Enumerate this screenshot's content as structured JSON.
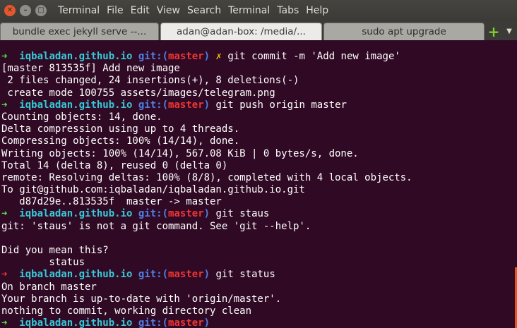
{
  "window": {
    "menu": [
      "Terminal",
      "File",
      "Edit",
      "View",
      "Search",
      "Terminal",
      "Tabs",
      "Help"
    ]
  },
  "tabs": [
    {
      "label": "bundle exec jekyll serve --...",
      "active": false
    },
    {
      "label": "adan@adan-box: /media/...",
      "active": true
    },
    {
      "label": "sudo apt upgrade",
      "active": false
    }
  ],
  "prompt": {
    "host": "iqbaladan.github.io",
    "git_label": "git:(",
    "branch": "master",
    "git_close": ")",
    "dirty_mark": "✗"
  },
  "terminal": {
    "lines": [
      {
        "type": "prompt",
        "arrow": "green",
        "dirty": true,
        "cmd": "git commit -m 'Add new image'"
      },
      {
        "type": "out",
        "text": "[master 813535f] Add new image"
      },
      {
        "type": "out",
        "text": " 2 files changed, 24 insertions(+), 8 deletions(-)"
      },
      {
        "type": "out",
        "text": " create mode 100755 assets/images/telegram.png"
      },
      {
        "type": "prompt",
        "arrow": "green",
        "dirty": false,
        "cmd": "git push origin master"
      },
      {
        "type": "out",
        "text": "Counting objects: 14, done."
      },
      {
        "type": "out",
        "text": "Delta compression using up to 4 threads."
      },
      {
        "type": "out",
        "text": "Compressing objects: 100% (14/14), done."
      },
      {
        "type": "out",
        "text": "Writing objects: 100% (14/14), 567.08 KiB | 0 bytes/s, done."
      },
      {
        "type": "out",
        "text": "Total 14 (delta 8), reused 0 (delta 0)"
      },
      {
        "type": "out",
        "text": "remote: Resolving deltas: 100% (8/8), completed with 4 local objects."
      },
      {
        "type": "out",
        "text": "To git@github.com:iqbaladan/iqbaladan.github.io.git"
      },
      {
        "type": "out",
        "text": "   d87d29e..813535f  master -> master"
      },
      {
        "type": "prompt",
        "arrow": "green",
        "dirty": false,
        "cmd": "git staus"
      },
      {
        "type": "out",
        "text": "git: 'staus' is not a git command. See 'git --help'."
      },
      {
        "type": "out",
        "text": ""
      },
      {
        "type": "out",
        "text": "Did you mean this?"
      },
      {
        "type": "out",
        "text": "        status"
      },
      {
        "type": "prompt",
        "arrow": "red",
        "dirty": false,
        "cmd": "git status"
      },
      {
        "type": "out",
        "text": "On branch master"
      },
      {
        "type": "out",
        "text": "Your branch is up-to-date with 'origin/master'."
      },
      {
        "type": "out",
        "text": "nothing to commit, working directory clean"
      },
      {
        "type": "prompt",
        "arrow": "green",
        "dirty": false,
        "cmd": ""
      }
    ]
  },
  "colors": {
    "background": "#300a24",
    "arrow_green": "#4ee34e",
    "arrow_red": "#f03535",
    "host": "#36c9d9",
    "git_label": "#4f7fe6",
    "branch": "#f03535",
    "dirty_mark": "#e8c200",
    "scrollbar": "#e9541f"
  },
  "icons": {
    "close": "close-icon",
    "minimize": "minimize-icon",
    "maximize": "maximize-icon",
    "add_tab": "plus-icon",
    "tab_menu": "chevron-down-icon"
  }
}
